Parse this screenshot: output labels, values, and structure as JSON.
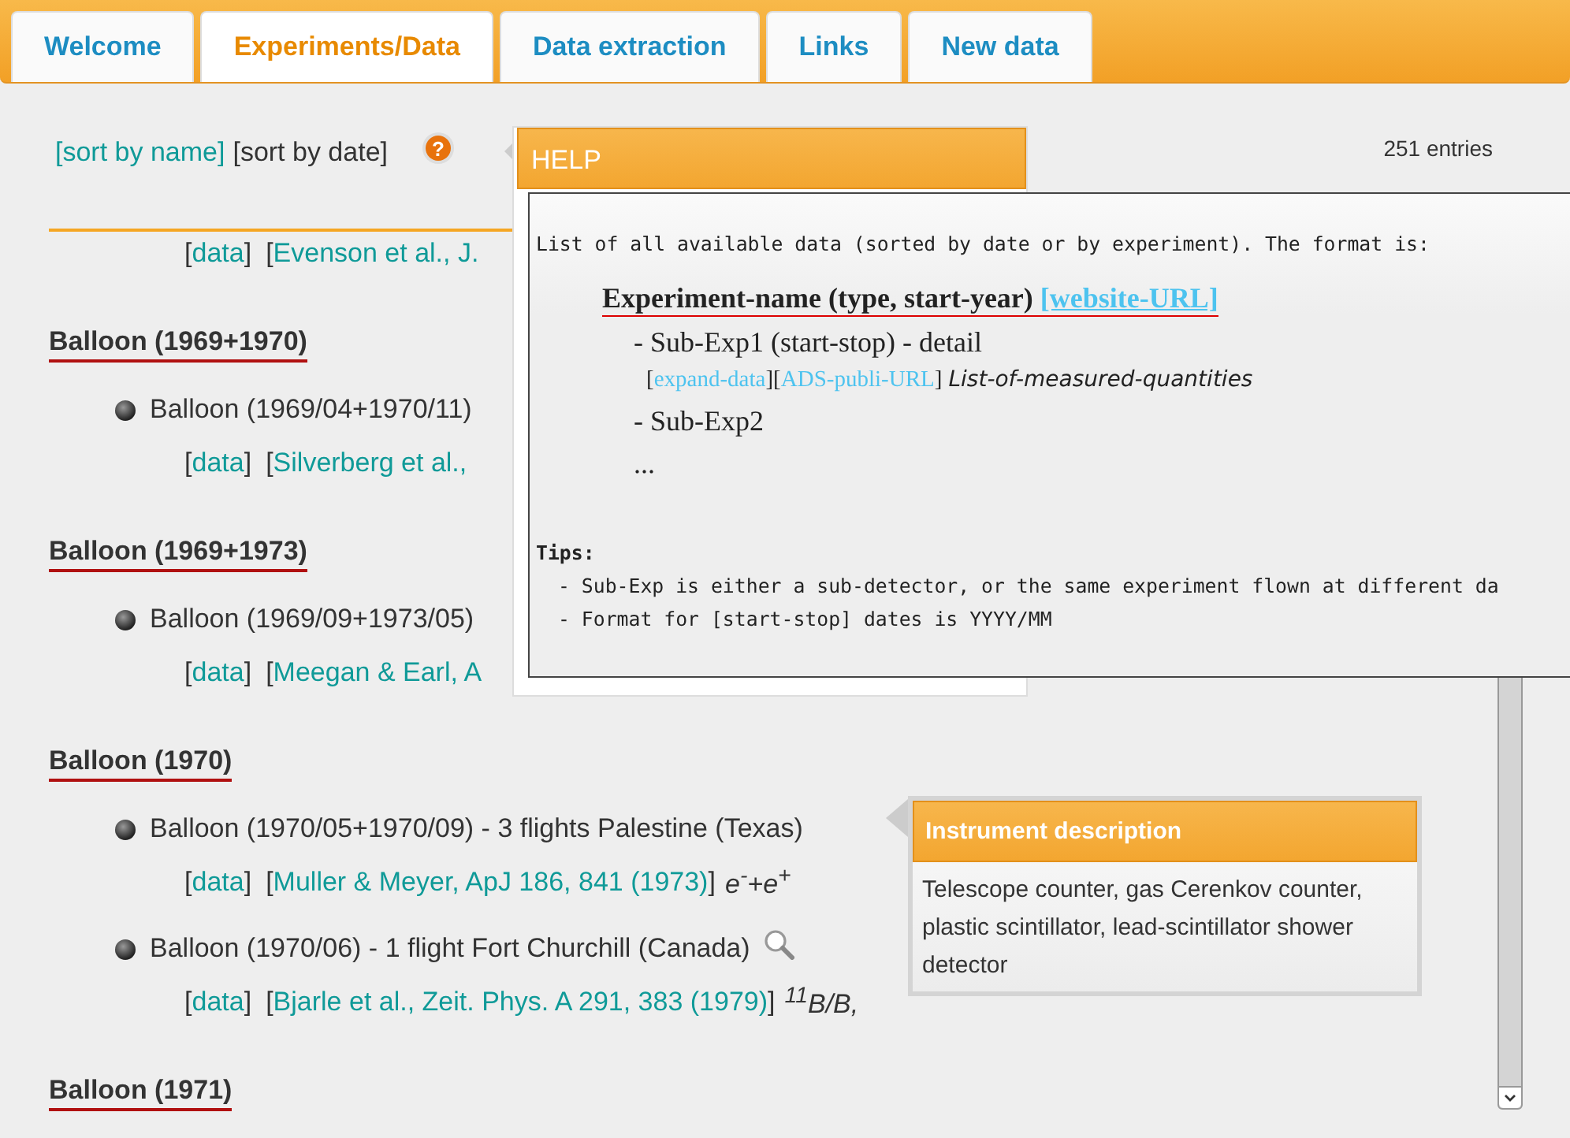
{
  "tabs": [
    {
      "label": "Welcome",
      "selected": false
    },
    {
      "label": "Experiments/Data",
      "selected": true
    },
    {
      "label": "Data extraction",
      "selected": false
    },
    {
      "label": "Links",
      "selected": false
    },
    {
      "label": "New data",
      "selected": false
    }
  ],
  "sort_links": [
    {
      "label": "[sort by name]",
      "selected": false
    },
    {
      "label": "[sort by date]",
      "selected": true
    }
  ],
  "help_icon": "?",
  "entries_count": "251 entries",
  "groups": [
    {
      "items": [
        {
          "refs": [
            {
              "open": "[",
              "label": "data",
              "close": "]"
            },
            {
              "open": "[",
              "label": "Evenson et al., J."
            }
          ]
        }
      ]
    },
    {
      "title": "Balloon (1969+1970)",
      "items": [
        {
          "label": "Balloon (1969/04+1970/11)",
          "refs": [
            {
              "open": "[",
              "label": "data",
              "close": "]"
            },
            {
              "open": "[",
              "label": "Silverberg et al.,"
            }
          ]
        }
      ]
    },
    {
      "title": "Balloon (1969+1973)",
      "items": [
        {
          "label": "Balloon (1969/09+1973/05)",
          "refs": [
            {
              "open": "[",
              "label": "data",
              "close": "]"
            },
            {
              "open": "[",
              "label": "Meegan & Earl, A"
            }
          ]
        }
      ]
    },
    {
      "title": "Balloon (1970)",
      "items": [
        {
          "label": "Balloon (1970/05+1970/09) - 3 flights Palestine (Texas)",
          "refs": [
            {
              "open": "[",
              "label": "data",
              "close": "]"
            },
            {
              "open": "[",
              "label": "Muller & Meyer, ApJ 186, 841 (1973)",
              "close": "]"
            }
          ],
          "quantities": "e$^{-}$+e$^{+}$"
        },
        {
          "label": "Balloon (1970/06) - 1 flight Fort Churchill (Canada)",
          "magnifier": true,
          "refs": [
            {
              "open": "[",
              "label": "data",
              "close": "]"
            },
            {
              "open": "[",
              "label": "Bjarle et al., Zeit. Phys. A 291, 383 (1979)",
              "close": "]"
            }
          ],
          "quantities": "$^{11}$B/B,"
        }
      ]
    },
    {
      "title": "Balloon (1971)"
    }
  ],
  "help_popup": {
    "title": "HELP",
    "intro": "List of all available data (sorted by date or by experiment). The format is:",
    "format_title": "Experiment-name (type, start-year)",
    "format_link": "[website-URL]",
    "format_sub1": "- Sub-Exp1 (start-stop) - detail",
    "format_links": [
      {
        "open": "[",
        "label": "expand-data",
        "close": "]"
      },
      {
        "open": "[",
        "label": "ADS-publi-URL",
        "close": "]"
      }
    ],
    "format_quantities": "List-of-measured-quantities",
    "format_sub2": "- Sub-Exp2",
    "format_more": "...",
    "tips_title": "Tips:",
    "tips": [
      "- Sub-Exp is either a sub-detector, or the same experiment flown at different da",
      "- Format for [start-stop] dates is YYYY/MM"
    ]
  },
  "instrument_popup": {
    "title": "Instrument description",
    "body": "Telescope counter, gas Cerenkov counter, plastic scintillator, lead-scintillator shower detector"
  }
}
